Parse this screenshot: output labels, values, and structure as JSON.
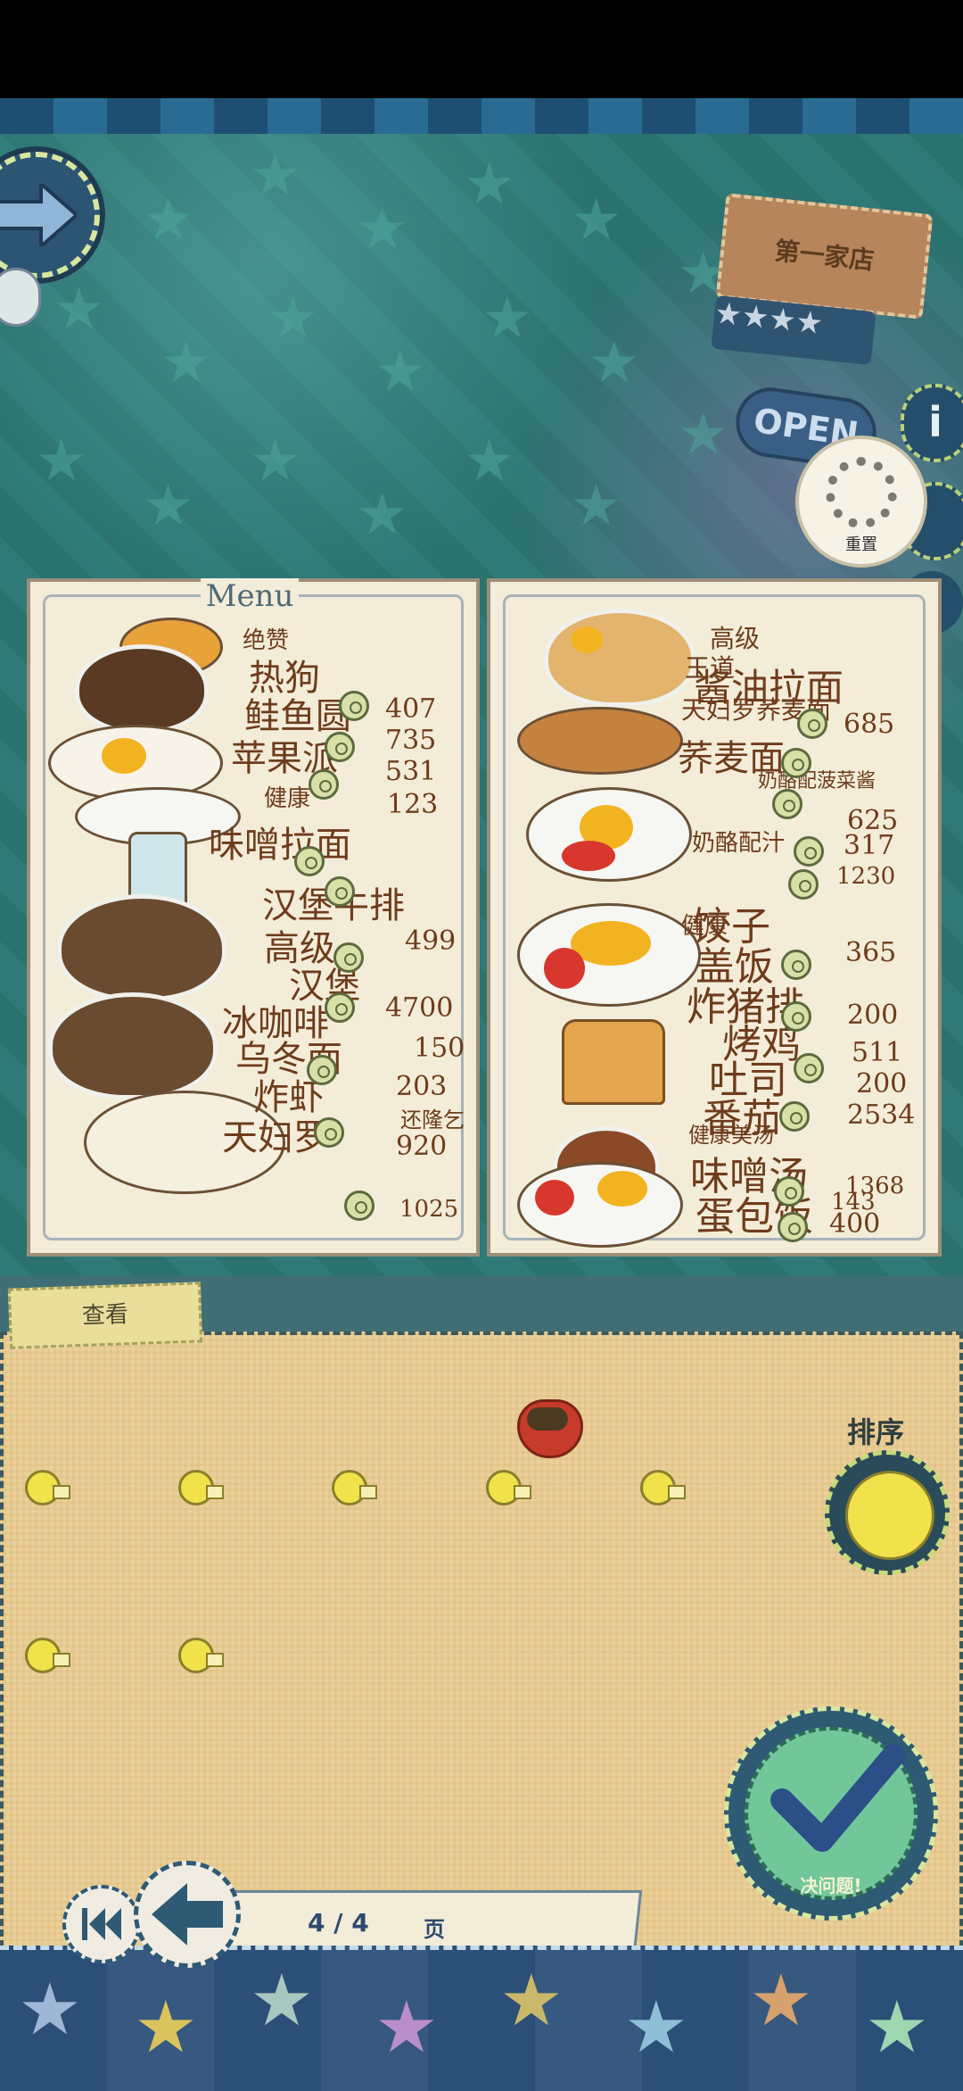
{
  "shop": {
    "name": "第一家店",
    "stars": "★★★★",
    "open_label": "OPEN",
    "info_label": "i",
    "reset_label": "重置"
  },
  "menu": {
    "title": "Menu",
    "left_texts": [
      "绝赞",
      "热狗",
      "鲑鱼圆",
      "407",
      "苹果派",
      "735",
      "531",
      "健康",
      "123",
      "味噌拉面",
      "汉堡牛排",
      "高级",
      "499",
      "汉堡",
      "冰咖啡",
      "4700",
      "乌冬面",
      "150",
      "炸虾",
      "203",
      "天妇罗",
      "还隆乞",
      "920",
      "1025"
    ],
    "right_texts": [
      "高级",
      "王道",
      "酱油拉面",
      "天妇罗荞麦面",
      "685",
      "荞麦面",
      "奶酪配菠菜酱",
      "625",
      "奶酪配汁",
      "317",
      "1230",
      "饺子",
      "盖饭",
      "健康",
      "365",
      "炸猪排",
      "烤鸡",
      "200",
      "吐司",
      "511",
      "番茄",
      "200",
      "健康美汤",
      "2534",
      "味噌汤",
      "蛋包饭",
      "1368",
      "143",
      "400"
    ]
  },
  "panel": {
    "view_tab": "查看",
    "sort_label": "排序",
    "confirm_label": "决问题!",
    "pager_value": "4 / 4",
    "pager_unit": "页"
  }
}
